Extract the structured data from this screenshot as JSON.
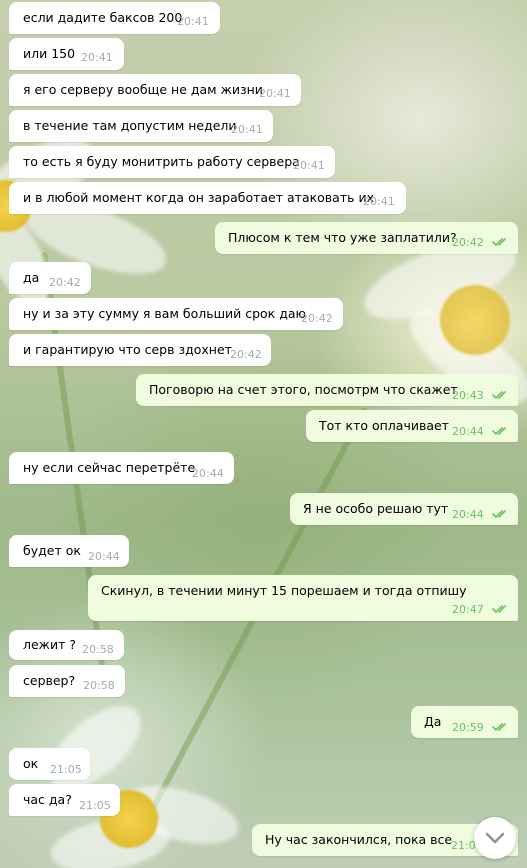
{
  "colors": {
    "incoming_bubble": "#ffffff",
    "outgoing_bubble": "#effdde",
    "incoming_time": "#a0acb6",
    "outgoing_time": "#6cbf65",
    "read_check": "#6cbf65"
  },
  "scroll_button": {
    "icon": "chevron-down-icon"
  },
  "messages": [
    {
      "direction": "in",
      "text": "если дадите баксов 200",
      "time": "20:41"
    },
    {
      "direction": "in",
      "text": "или 150",
      "time": "20:41"
    },
    {
      "direction": "in",
      "text": "я его серверу вообще не дам жизни",
      "time": "20:41"
    },
    {
      "direction": "in",
      "text": "в течение там допустим недели",
      "time": "20:41"
    },
    {
      "direction": "in",
      "text": "то есть я буду монитрить работу сервера",
      "time": "20:41"
    },
    {
      "direction": "in",
      "text": "и в любой момент когда он заработает атаковать их",
      "time": "20:41"
    },
    {
      "direction": "out",
      "text": "Плюсом к тем что уже заплатили?",
      "time": "20:42",
      "status": "read"
    },
    {
      "direction": "in",
      "text": "да",
      "time": "20:42"
    },
    {
      "direction": "in",
      "text": "ну и за эту сумму я вам больший срок даю",
      "time": "20:42"
    },
    {
      "direction": "in",
      "text": "и гарантирую что серв здохнет",
      "time": "20:42"
    },
    {
      "direction": "out",
      "text": "Поговорю на счет этого, посмотрм что скажет",
      "time": "20:43",
      "status": "read"
    },
    {
      "direction": "out",
      "text": "Тот кто оплачивает",
      "time": "20:44",
      "status": "read"
    },
    {
      "direction": "in",
      "text": "ну если сейчас перетрёте",
      "time": "20:44"
    },
    {
      "direction": "out",
      "text": "Я не особо решаю тут",
      "time": "20:44",
      "status": "read"
    },
    {
      "direction": "in",
      "text": "будет ок",
      "time": "20:44"
    },
    {
      "direction": "out",
      "text": "Скинул, в течении минут 15 порешаем и тогда отпишу",
      "time": "20:47",
      "status": "read"
    },
    {
      "direction": "in",
      "text": "лежит ?",
      "time": "20:58"
    },
    {
      "direction": "in",
      "text": "сервер?",
      "time": "20:58"
    },
    {
      "direction": "out",
      "text": "Да",
      "time": "20:59",
      "status": "read"
    },
    {
      "direction": "in",
      "text": "ок",
      "time": "21:05"
    },
    {
      "direction": "in",
      "text": "час да?",
      "time": "21:05"
    },
    {
      "direction": "out",
      "text": "Ну час закончился, пока все",
      "time": "21:07",
      "status": "read"
    }
  ]
}
